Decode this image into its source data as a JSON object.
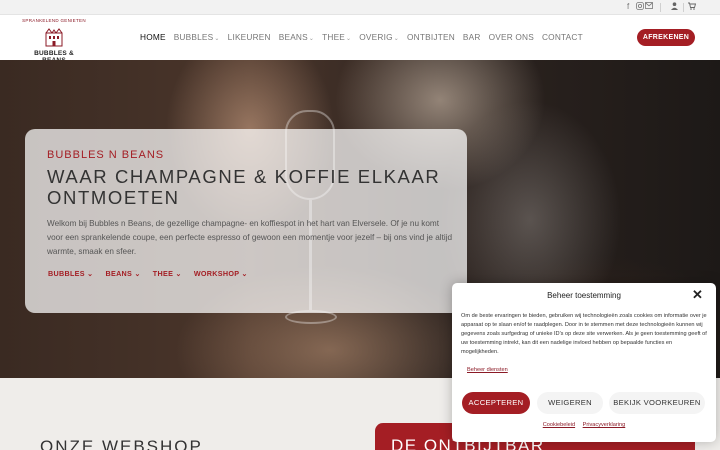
{
  "topbar": {
    "icons": [
      "facebook-icon",
      "instagram-icon",
      "email-icon",
      "user-icon",
      "cart-icon"
    ]
  },
  "brand": {
    "arc_text": "SPRANKELEND GENIETEN",
    "name": "BUBBLES & BEANS"
  },
  "nav": {
    "items": [
      {
        "label": "HOME",
        "dropdown": false
      },
      {
        "label": "BUBBLES",
        "dropdown": true
      },
      {
        "label": "LIKEUREN",
        "dropdown": false
      },
      {
        "label": "BEANS",
        "dropdown": true
      },
      {
        "label": "THEE",
        "dropdown": true
      },
      {
        "label": "OVERIG",
        "dropdown": true
      },
      {
        "label": "ONTBIJTEN",
        "dropdown": false
      },
      {
        "label": "BAR",
        "dropdown": false
      },
      {
        "label": "OVER ONS",
        "dropdown": false
      },
      {
        "label": "CONTACT",
        "dropdown": false
      }
    ],
    "cta": "AFREKENEN"
  },
  "hero": {
    "eyebrow": "BUBBLES N BEANS",
    "title": "WAAR CHAMPAGNE & KOFFIE ELKAAR ONTMOETEN",
    "description": "Welkom bij Bubbles n Beans, de gezellige champagne- en koffiespot in het hart van Elversele. Of je nu komt voor een sprankelende coupe, een perfecte espresso of gewoon een momentje voor jezelf – bij ons vind je altijd warmte, smaak en sfeer.",
    "links": [
      "BUBBLES",
      "BEANS",
      "THEE",
      "WORKSHOP"
    ]
  },
  "sections": {
    "left_title": "ONZE WEBSHOP",
    "right_title": "DE ONTBIJTBAR"
  },
  "cookie": {
    "title": "Beheer toestemming",
    "body": "Om de beste ervaringen te bieden, gebruiken wij technologieën zoals cookies om informatie over je apparaat op te slaan en/of te raadplegen. Door in te stemmen met deze technologieën kunnen wij gegevens zoals surfgedrag of unieke ID's op deze site verwerken. Als je geen toestemming geeft of uw toestemming intrekt, kan dit een nadelige invloed hebben op bepaalde functies en mogelijkheden.",
    "manage": "Beheer diensten",
    "accept": "ACCEPTEREN",
    "deny": "WEIGEREN",
    "preferences": "BEKIJK VOORKEUREN",
    "cookie_policy": "Cookiebeleid",
    "privacy": "Privacyverklaring"
  },
  "colors": {
    "accent": "#a41e24"
  }
}
